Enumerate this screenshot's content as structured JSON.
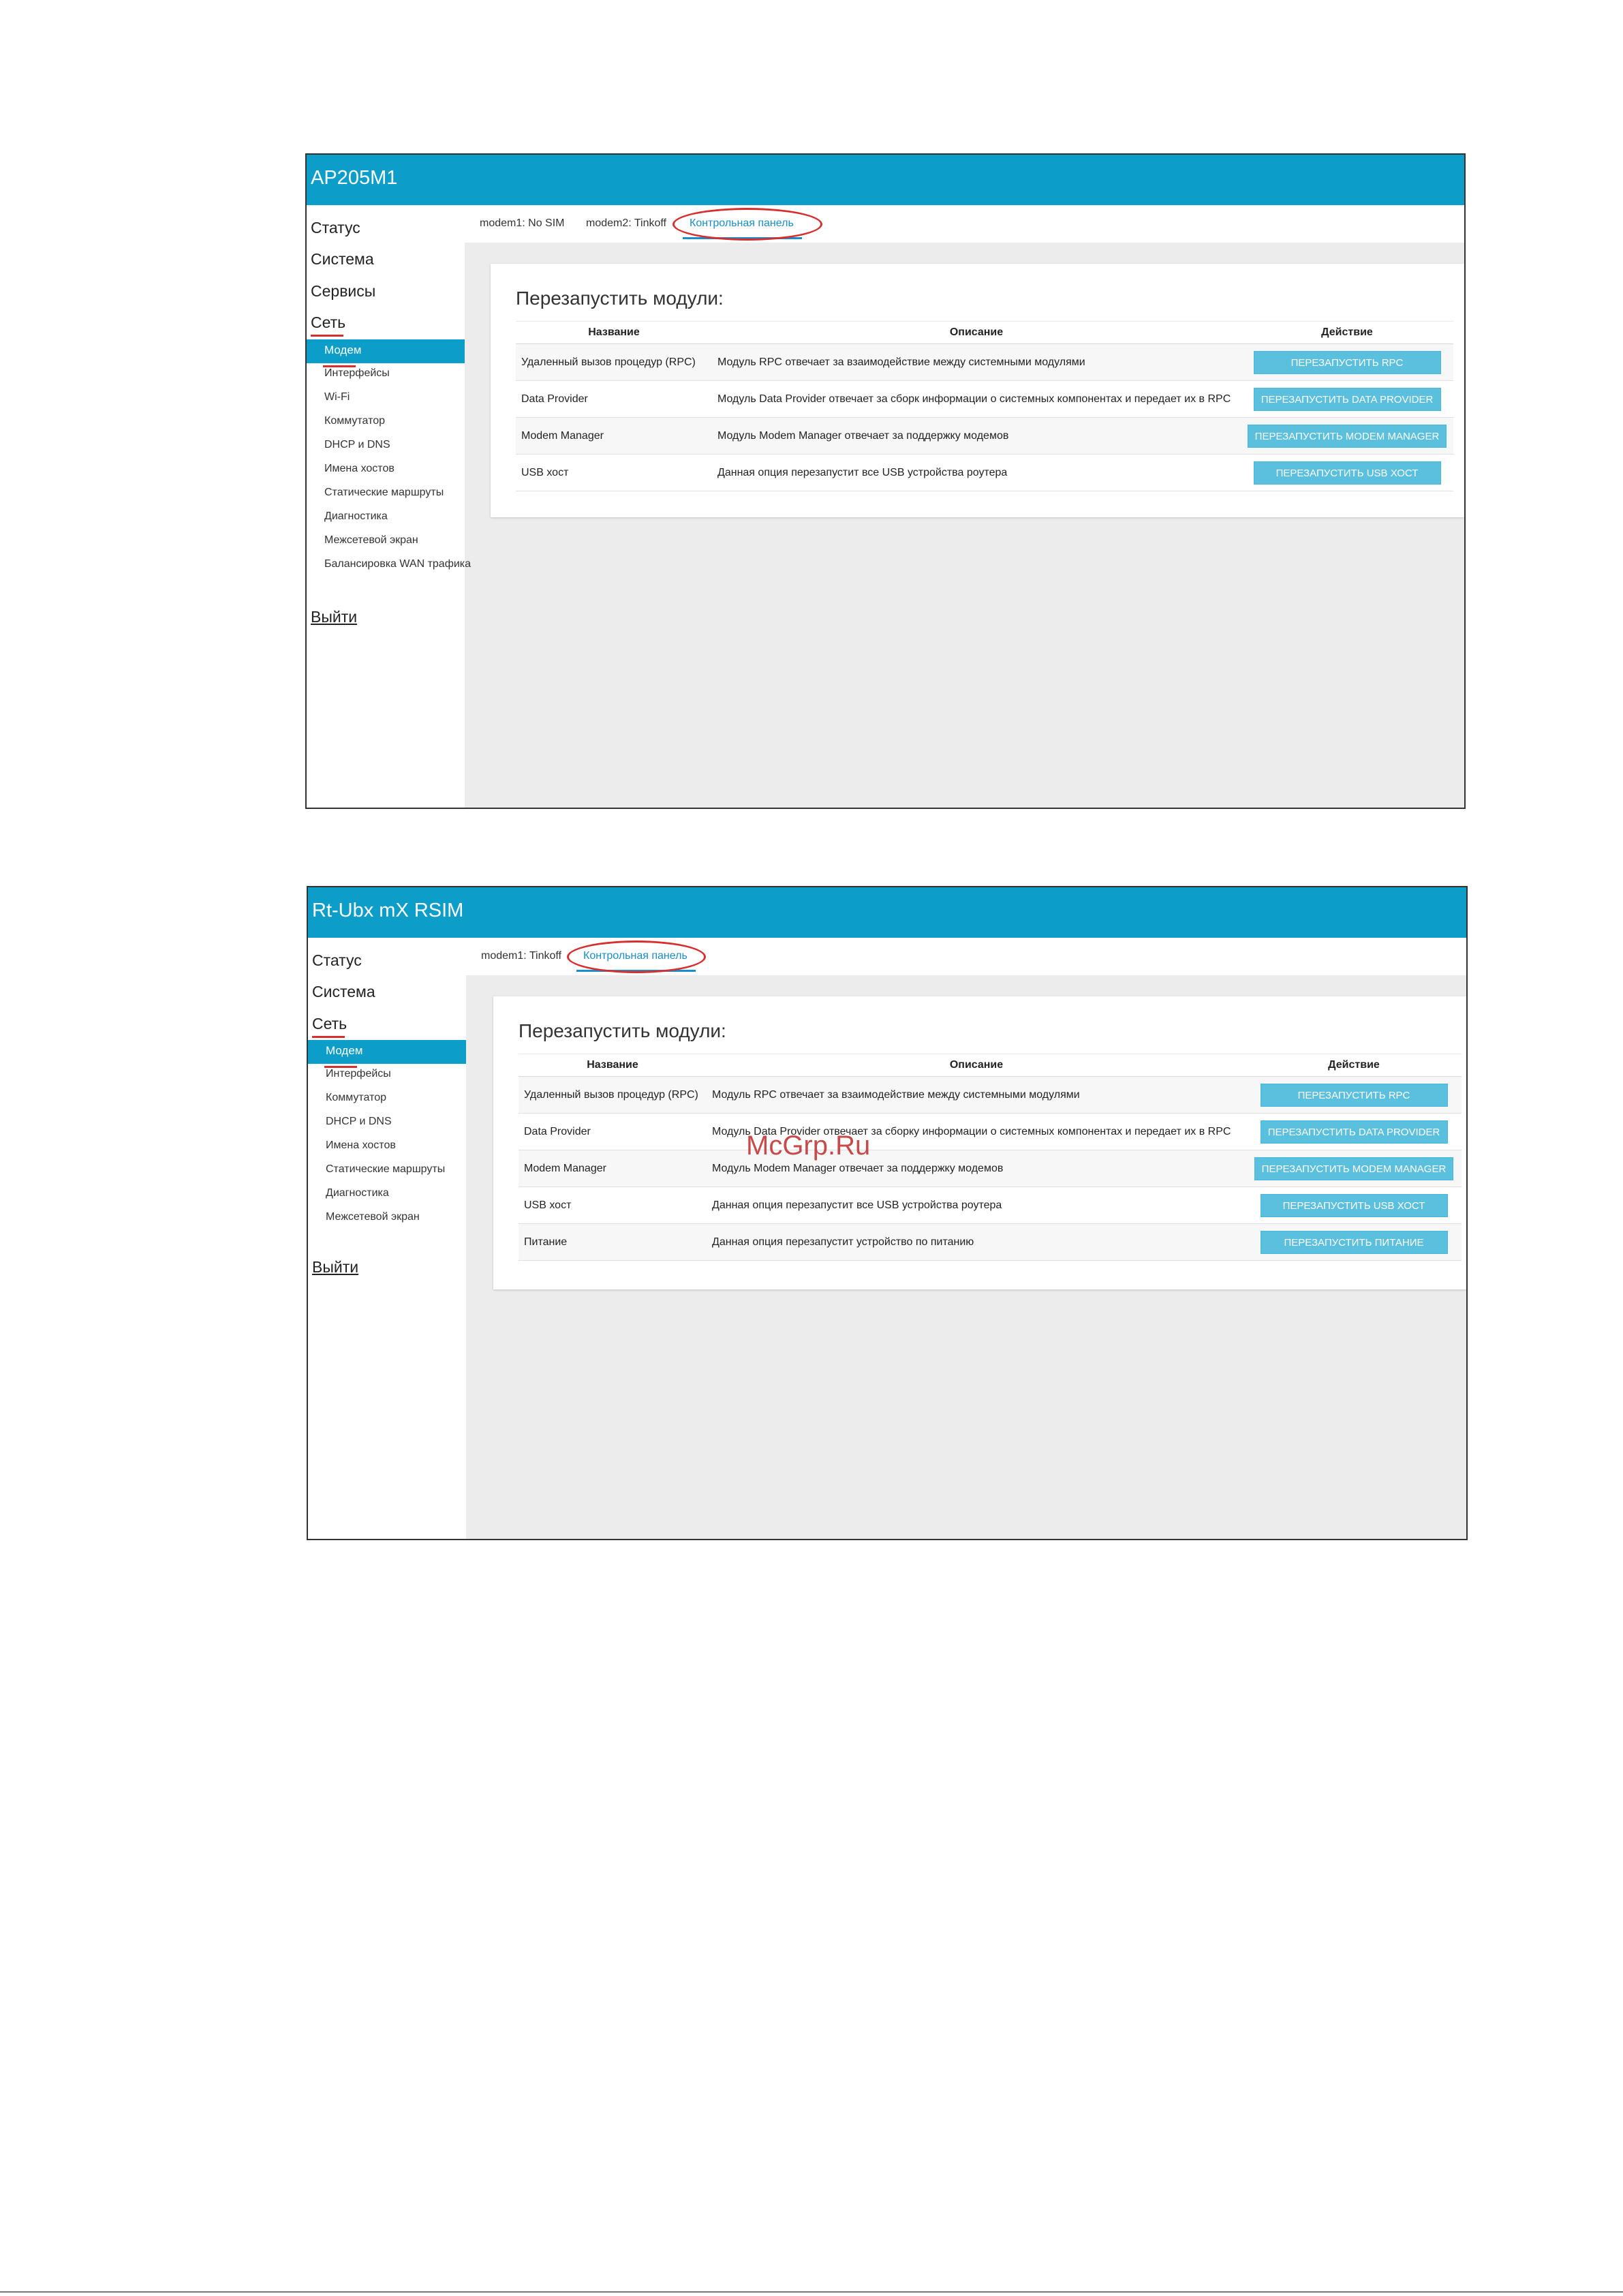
{
  "screen1": {
    "app_title": "AP205M1",
    "sidebar": {
      "sections": [
        "Статус",
        "Система",
        "Сервисы",
        "Сеть"
      ],
      "active_section": "Сеть",
      "active_item": "Модем",
      "items": [
        "Интерфейсы",
        "Wi-Fi",
        "Коммутатор",
        "DHCP и DNS",
        "Имена хостов",
        "Статические маршруты",
        "Диагностика",
        "Межсетевой экран",
        "Балансировка WAN трафика"
      ],
      "logout": "Выйти"
    },
    "tabs": [
      "modem1: No SIM",
      "modem2: Tinkoff",
      "Контрольная панель"
    ],
    "active_tab": "Контрольная панель",
    "panel_title": "Перезапустить модули:",
    "table_headers": [
      "Название",
      "Описание",
      "Действие"
    ],
    "rows": [
      {
        "name": "Удаленный вызов процедур (RPC)",
        "description": "Модуль RPC отвечает за взаимодействие между системными модулями",
        "action": "ПЕРЕЗАПУСТИТЬ RPC"
      },
      {
        "name": "Data Provider",
        "description": "Модуль Data Provider отвечает за сборк информации о системных компонентах и передает их в RPC",
        "action": "ПЕРЕЗАПУСТИТЬ DATA PROVIDER"
      },
      {
        "name": "Modem Manager",
        "description": "Модуль Modem Manager отвечает за поддержку модемов",
        "action": "ПЕРЕЗАПУСТИТЬ MODEM MANAGER"
      },
      {
        "name": "USB хост",
        "description": "Данная опция перезапустит все USB устройства роутера",
        "action": "ПЕРЕЗАПУСТИТЬ USB ХОСТ"
      }
    ]
  },
  "screen2": {
    "app_title": "Rt-Ubx mX RSIM",
    "sidebar": {
      "sections": [
        "Статус",
        "Система",
        "Сеть"
      ],
      "active_section": "Сеть",
      "active_item": "Модем",
      "items": [
        "Интерфейсы",
        "Коммутатор",
        "DHCP и DNS",
        "Имена хостов",
        "Статические маршруты",
        "Диагностика",
        "Межсетевой экран"
      ],
      "logout": "Выйти"
    },
    "tabs": [
      "modem1: Tinkoff",
      "Контрольная панель"
    ],
    "active_tab": "Контрольная панель",
    "panel_title": "Перезапустить модули:",
    "table_headers": [
      "Название",
      "Описание",
      "Действие"
    ],
    "rows": [
      {
        "name": "Удаленный вызов процедур (RPC)",
        "description": "Модуль RPC отвечает за взаимодействие между системными модулями",
        "action": "ПЕРЕЗАПУСТИТЬ RPC"
      },
      {
        "name": "Data Provider",
        "description": "Модуль Data Provider отвечает за сборку информации о системных компонентах и передает их в RPC",
        "action": "ПЕРЕЗАПУСТИТЬ DATA PROVIDER"
      },
      {
        "name": "Modem Manager",
        "description": "Модуль Modem Manager отвечает за поддержку модемов",
        "action": "ПЕРЕЗАПУСТИТЬ MODEM MANAGER"
      },
      {
        "name": "USB хост",
        "description": "Данная опция перезапустит все USB устройства роутера",
        "action": "ПЕРЕЗАПУСТИТЬ USB ХОСТ"
      },
      {
        "name": "Питание",
        "description": "Данная опция перезапустит устройство по питанию",
        "action": "ПЕРЕЗАПУСТИТЬ ПИТАНИЕ"
      }
    ]
  },
  "watermark": "McGrp.Ru",
  "colors": {
    "header": "#0d9dc9",
    "button": "#5bc0de",
    "highlight": "#d62f2f",
    "active_tab": "#1a8fc7"
  }
}
